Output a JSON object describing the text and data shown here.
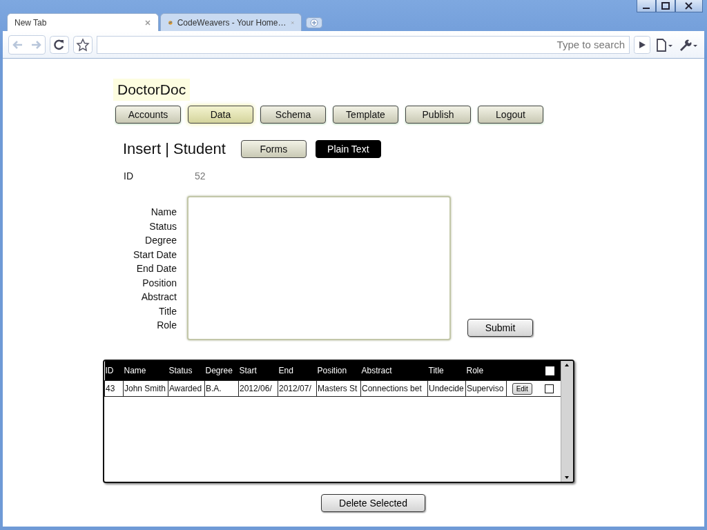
{
  "tabs": [
    {
      "label": "New Tab",
      "selected": true
    },
    {
      "label": "CodeWeavers - Your Home…",
      "selected": false
    }
  ],
  "address_bar": {
    "placeholder": "Type to search"
  },
  "app": {
    "logo": "DoctorDoc",
    "nav": [
      {
        "label": "Accounts",
        "selected": false
      },
      {
        "label": "Data",
        "selected": true
      },
      {
        "label": "Schema",
        "selected": false
      },
      {
        "label": "Template",
        "selected": false
      },
      {
        "label": "Publish",
        "selected": false
      },
      {
        "label": "Logout",
        "selected": false
      }
    ],
    "heading": "Insert | Student",
    "modes": [
      {
        "label": "Forms",
        "selected": false
      },
      {
        "label": "Plain Text",
        "selected": true
      }
    ],
    "id_label": "ID",
    "id_value": "52",
    "field_labels": [
      "Name",
      "Status",
      "Degree",
      "Start Date",
      "End Date",
      "Position",
      "Abstract",
      "Title",
      "Role"
    ],
    "submit": "Submit"
  },
  "table": {
    "columns": [
      "ID",
      "Name",
      "Status",
      "Degree",
      "Start",
      "End",
      "Position",
      "Abstract",
      "Title",
      "Role"
    ],
    "header_checkbox": {
      "checked": false
    },
    "rows": [
      {
        "cells": [
          "43",
          "John Smith",
          "Awarded",
          "B.A.",
          "2012/06/",
          "2012/07/",
          "Masters St",
          "Connections bet",
          "Undecide",
          "Superviso"
        ],
        "action": "Edit",
        "checked": false
      }
    ]
  },
  "delete_button": "Delete Selected"
}
